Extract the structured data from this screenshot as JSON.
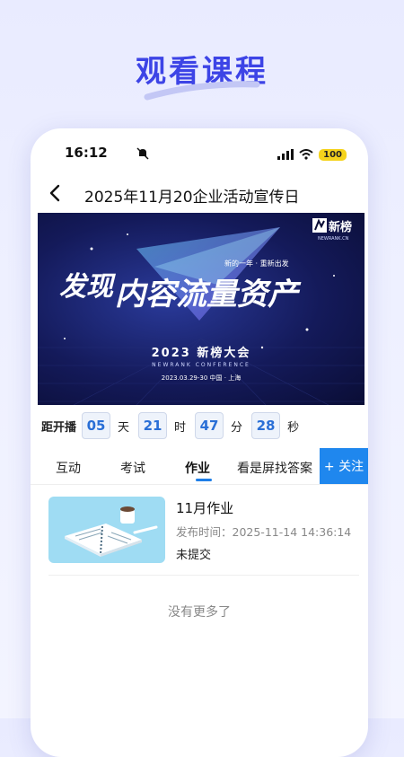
{
  "headline": "观看课程",
  "status_bar": {
    "time": "16:12",
    "battery": "100"
  },
  "nav": {
    "back_icon": "chevron-left-icon",
    "title": "2025年11月20企业活动宣传日"
  },
  "banner": {
    "logo_text": "新榜",
    "logo_sub": "NEWRANK.CN",
    "tagline": "新的一年 · 重新出发",
    "main_text_left": "发现",
    "main_text": "内容流量资产",
    "event_title": "2023 新榜大会",
    "event_sub": "NEWRANK CONFERENCE",
    "event_date": "2023.03.29-30  中国 · 上海"
  },
  "countdown": {
    "label": "距开播",
    "days": "05",
    "days_unit": "天",
    "hours": "21",
    "hours_unit": "时",
    "minutes": "47",
    "minutes_unit": "分",
    "seconds": "28",
    "seconds_unit": "秒"
  },
  "tabs": [
    {
      "label": "互动"
    },
    {
      "label": "考试"
    },
    {
      "label": "作业",
      "active": true
    },
    {
      "label": "看是屏找答案"
    }
  ],
  "follow_button": "+ 关注",
  "homework": {
    "title": "11月作业",
    "time_label": "发布时间：2025-11-14 14:36:14",
    "status": "未提交"
  },
  "footer_text": "没有更多了",
  "colors": {
    "accent": "#1f87ee",
    "headline": "#3d44e6",
    "countdown": "#2a6fd6"
  }
}
